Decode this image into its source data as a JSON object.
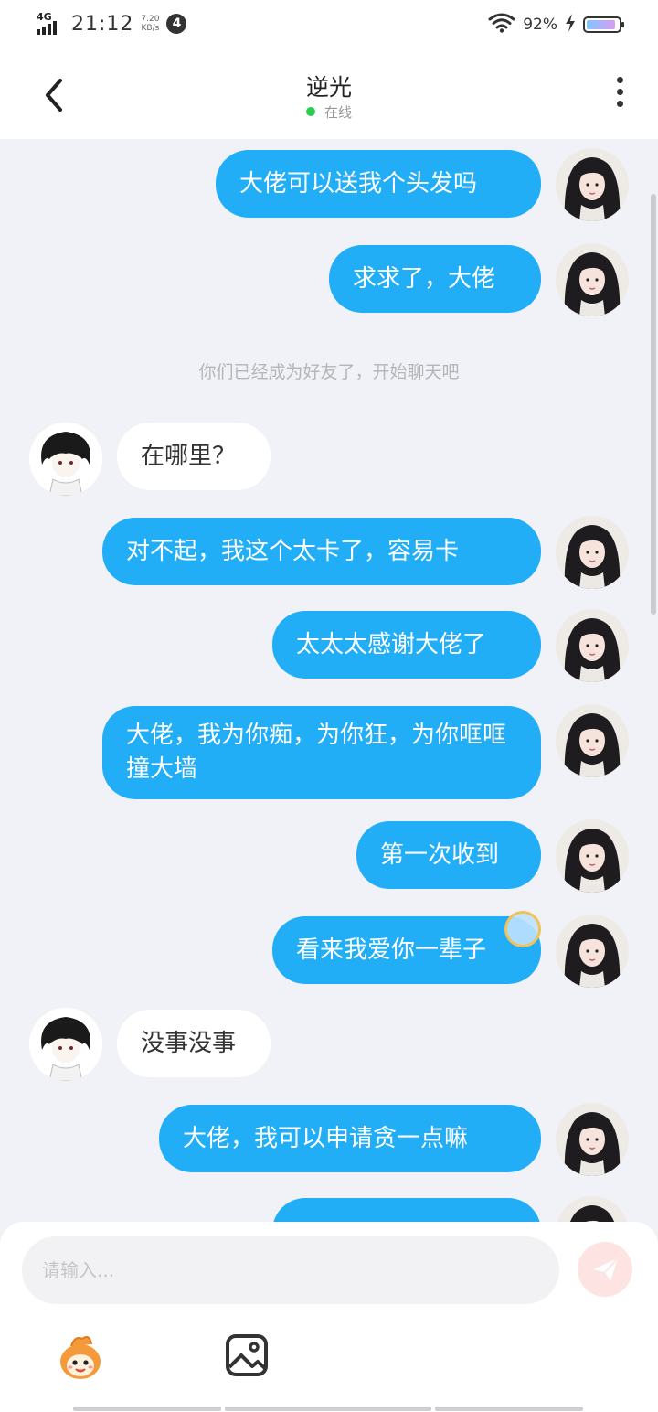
{
  "status_bar": {
    "network": "4G",
    "time": "21:12",
    "speed_value": "7.20",
    "speed_unit": "KB/s",
    "notification_count": "4",
    "battery_percent": "92%",
    "battery_level": 0.92
  },
  "header": {
    "title": "逆光",
    "status": "在线",
    "status_color": "#2ccc4f"
  },
  "messages": [
    {
      "from": "me",
      "text": "大佬可以送我个头发吗"
    },
    {
      "from": "me",
      "text": "求求了，大佬"
    },
    {
      "from": "system",
      "text": "你们已经成为好友了，开始聊天吧"
    },
    {
      "from": "them",
      "text": "在哪里？"
    },
    {
      "from": "me",
      "text": "对不起，我这个太卡了，容易卡"
    },
    {
      "from": "me",
      "text": "太太太感谢大佬了"
    },
    {
      "from": "me",
      "text": "大佬，我为你痴，为你狂，为你哐哐撞大墙"
    },
    {
      "from": "me",
      "text": "第一次收到"
    },
    {
      "from": "me",
      "text": "看来我爱你一辈子"
    },
    {
      "from": "them",
      "text": "没事没事"
    },
    {
      "from": "me",
      "text": "大佬，我可以申请贪一点嘛"
    },
    {
      "from": "me",
      "text": ""
    }
  ],
  "input": {
    "placeholder": "请输入..."
  },
  "colors": {
    "my_bubble": "#21aef7",
    "their_bubble": "#ffffff",
    "background": "#f1f2f7",
    "send_button": "#fde4e2"
  },
  "icons": {
    "back": "back-arrow-icon",
    "more": "more-vertical-icon",
    "send": "send-icon",
    "emoji": "emoji-mascot-icon",
    "image": "image-icon"
  }
}
